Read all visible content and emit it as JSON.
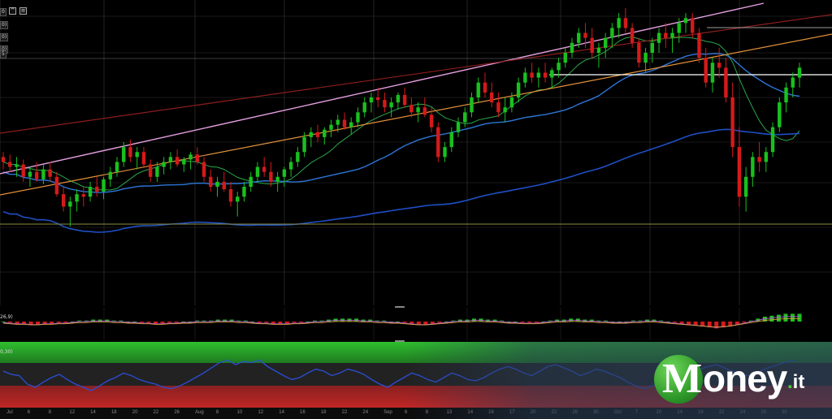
{
  "chart_data": {
    "type": "candlestick",
    "main": {
      "indicator_badges": [
        "0",
        "0)",
        "0)",
        "0)",
        "5"
      ],
      "ohlc": [
        [
          60,
          62,
          55,
          58
        ],
        [
          58,
          61,
          54,
          56
        ],
        [
          56,
          60,
          52,
          57
        ],
        [
          57,
          59,
          50,
          52
        ],
        [
          52,
          56,
          48,
          54
        ],
        [
          54,
          58,
          50,
          51
        ],
        [
          51,
          57,
          49,
          55
        ],
        [
          55,
          58,
          50,
          52
        ],
        [
          52,
          54,
          44,
          45
        ],
        [
          45,
          48,
          38,
          40
        ],
        [
          40,
          44,
          32,
          42
        ],
        [
          42,
          47,
          38,
          45
        ],
        [
          45,
          48,
          40,
          44
        ],
        [
          44,
          50,
          42,
          48
        ],
        [
          48,
          52,
          44,
          46
        ],
        [
          46,
          52,
          43,
          51
        ],
        [
          51,
          56,
          48,
          54
        ],
        [
          54,
          60,
          52,
          58
        ],
        [
          58,
          66,
          56,
          64
        ],
        [
          64,
          67,
          58,
          60
        ],
        [
          60,
          64,
          55,
          62
        ],
        [
          62,
          64,
          56,
          57
        ],
        [
          57,
          59,
          50,
          52
        ],
        [
          52,
          58,
          50,
          56
        ],
        [
          56,
          60,
          53,
          58
        ],
        [
          58,
          62,
          55,
          60
        ],
        [
          60,
          63,
          56,
          57
        ],
        [
          57,
          60,
          54,
          59
        ],
        [
          59,
          62,
          55,
          61
        ],
        [
          61,
          64,
          57,
          58
        ],
        [
          58,
          60,
          50,
          52
        ],
        [
          52,
          55,
          46,
          48
        ],
        [
          48,
          52,
          44,
          50
        ],
        [
          50,
          54,
          46,
          47
        ],
        [
          47,
          50,
          40,
          42
        ],
        [
          42,
          46,
          36,
          44
        ],
        [
          44,
          50,
          42,
          48
        ],
        [
          48,
          54,
          46,
          52
        ],
        [
          52,
          58,
          50,
          56
        ],
        [
          56,
          60,
          52,
          54
        ],
        [
          54,
          58,
          48,
          50
        ],
        [
          50,
          54,
          46,
          52
        ],
        [
          52,
          56,
          48,
          55
        ],
        [
          55,
          60,
          52,
          58
        ],
        [
          58,
          64,
          56,
          62
        ],
        [
          62,
          70,
          60,
          68
        ],
        [
          68,
          72,
          64,
          70
        ],
        [
          70,
          73,
          66,
          68
        ],
        [
          68,
          72,
          65,
          71
        ],
        [
          71,
          75,
          68,
          73
        ],
        [
          73,
          77,
          70,
          75
        ],
        [
          75,
          78,
          71,
          72
        ],
        [
          72,
          76,
          69,
          74
        ],
        [
          74,
          80,
          72,
          78
        ],
        [
          78,
          84,
          76,
          82
        ],
        [
          82,
          86,
          78,
          84
        ],
        [
          84,
          88,
          80,
          83
        ],
        [
          83,
          86,
          78,
          80
        ],
        [
          80,
          84,
          76,
          82
        ],
        [
          82,
          86,
          79,
          85
        ],
        [
          85,
          88,
          80,
          81
        ],
        [
          81,
          84,
          76,
          78
        ],
        [
          78,
          82,
          74,
          80
        ],
        [
          80,
          84,
          76,
          77
        ],
        [
          77,
          80,
          70,
          72
        ],
        [
          72,
          74,
          58,
          60
        ],
        [
          60,
          66,
          58,
          64
        ],
        [
          64,
          72,
          62,
          70
        ],
        [
          70,
          76,
          68,
          74
        ],
        [
          74,
          80,
          72,
          78
        ],
        [
          78,
          86,
          76,
          84
        ],
        [
          84,
          92,
          82,
          90
        ],
        [
          90,
          94,
          84,
          86
        ],
        [
          86,
          90,
          80,
          82
        ],
        [
          82,
          86,
          76,
          78
        ],
        [
          78,
          84,
          74,
          80
        ],
        [
          80,
          86,
          78,
          84
        ],
        [
          84,
          92,
          82,
          90
        ],
        [
          90,
          96,
          88,
          94
        ],
        [
          94,
          98,
          90,
          92
        ],
        [
          92,
          96,
          88,
          94
        ],
        [
          94,
          98,
          90,
          92
        ],
        [
          92,
          96,
          88,
          95
        ],
        [
          95,
          100,
          92,
          98
        ],
        [
          98,
          104,
          96,
          102
        ],
        [
          102,
          108,
          100,
          106
        ],
        [
          106,
          112,
          104,
          110
        ],
        [
          110,
          114,
          104,
          108
        ],
        [
          108,
          112,
          100,
          102
        ],
        [
          102,
          106,
          96,
          104
        ],
        [
          104,
          110,
          100,
          108
        ],
        [
          108,
          114,
          104,
          112
        ],
        [
          112,
          118,
          108,
          116
        ],
        [
          116,
          120,
          110,
          112
        ],
        [
          112,
          114,
          104,
          106
        ],
        [
          106,
          108,
          96,
          98
        ],
        [
          98,
          104,
          94,
          102
        ],
        [
          102,
          108,
          98,
          106
        ],
        [
          106,
          112,
          102,
          110
        ],
        [
          110,
          114,
          104,
          108
        ],
        [
          108,
          112,
          102,
          110
        ],
        [
          110,
          116,
          106,
          114
        ],
        [
          114,
          118,
          110,
          116
        ],
        [
          116,
          118,
          108,
          110
        ],
        [
          110,
          112,
          98,
          100
        ],
        [
          100,
          104,
          88,
          90
        ],
        [
          90,
          100,
          86,
          98
        ],
        [
          98,
          104,
          92,
          96
        ],
        [
          96,
          100,
          82,
          84
        ],
        [
          84,
          90,
          60,
          64
        ],
        [
          64,
          72,
          40,
          44
        ],
        [
          44,
          56,
          38,
          52
        ],
        [
          52,
          62,
          48,
          60
        ],
        [
          60,
          66,
          54,
          58
        ],
        [
          58,
          64,
          54,
          62
        ],
        [
          62,
          74,
          60,
          72
        ],
        [
          72,
          84,
          70,
          82
        ],
        [
          82,
          90,
          78,
          88
        ],
        [
          88,
          94,
          84,
          92
        ],
        [
          92,
          98,
          88,
          96
        ]
      ]
    },
    "macd_panel": {
      "label": "26,9)",
      "histogram": [
        0,
        -1,
        -2,
        -2,
        -3,
        -3,
        -2,
        -2,
        -1,
        -1,
        0,
        1,
        1,
        2,
        2,
        2,
        1,
        1,
        0,
        0,
        -1,
        -1,
        -2,
        -2,
        -1,
        -1,
        0,
        0,
        1,
        1,
        1,
        2,
        2,
        2,
        1,
        1,
        0,
        -1,
        -1,
        -2,
        -2,
        -2,
        -1,
        -1,
        0,
        1,
        1,
        2,
        3,
        3,
        3,
        3,
        2,
        2,
        1,
        1,
        0,
        0,
        -1,
        -2,
        -3,
        -3,
        -2,
        -1,
        0,
        1,
        2,
        2,
        3,
        3,
        2,
        2,
        1,
        0,
        0,
        -1,
        -1,
        -1,
        0,
        1,
        2,
        2,
        3,
        3,
        2,
        2,
        1,
        1,
        0,
        0,
        0,
        1,
        1,
        2,
        2,
        1,
        0,
        -1,
        -2,
        -3,
        -4,
        -5,
        -6,
        -7,
        -6,
        -5,
        -3,
        -1,
        1,
        3,
        5,
        6,
        7,
        8,
        8,
        8
      ]
    },
    "rsi_panel": {
      "label": "0,30)",
      "values": [
        55,
        50,
        48,
        35,
        30,
        38,
        45,
        50,
        42,
        35,
        30,
        25,
        32,
        40,
        45,
        52,
        48,
        42,
        38,
        35,
        30,
        28,
        32,
        38,
        45,
        52,
        60,
        68,
        72,
        65,
        70,
        68,
        72,
        62,
        55,
        48,
        42,
        45,
        52,
        58,
        55,
        48,
        52,
        58,
        55,
        50,
        42,
        35,
        30,
        38,
        45,
        52,
        48,
        42,
        38,
        45,
        52,
        48,
        42,
        40,
        45,
        52,
        58,
        62,
        58,
        52,
        48,
        55,
        62,
        65,
        60,
        55,
        48,
        52,
        58,
        55,
        50,
        45,
        38,
        32,
        28,
        32,
        38,
        45,
        50,
        55,
        60,
        58,
        62,
        65,
        60,
        55,
        50,
        48,
        52,
        58,
        62,
        66,
        70,
        72
      ]
    },
    "x_tick_labels": [
      "Jul",
      "6",
      "8",
      "12",
      "14",
      "18",
      "20",
      "22",
      "26",
      "Aug",
      "8",
      "10",
      "12",
      "14",
      "16",
      "18",
      "22",
      "24",
      "Sep",
      "6",
      "8",
      "13",
      "14",
      "16",
      "17",
      "20",
      "22",
      "26",
      "30",
      "Oct",
      "7",
      "10",
      "14",
      "18",
      "22",
      "24",
      "26",
      "30"
    ]
  },
  "logo": {
    "brand_m": "M",
    "brand_rest": "oney",
    "brand_dot": ".",
    "brand_tld": "it"
  },
  "colors": {
    "bull": "#19c11e",
    "bear": "#d41a1a",
    "ma_fast": "#2aa84a",
    "ma_mid": "#2d76d8",
    "ma_slow": "#1f4fc4",
    "trend_upper": "#e59fe0",
    "trend_orange": "#e3913a",
    "trend_red": "#8c1e1e",
    "level_white": "#ffffff",
    "level_olive": "#8c8c3c",
    "rsi_line": "#2b4ed8"
  }
}
